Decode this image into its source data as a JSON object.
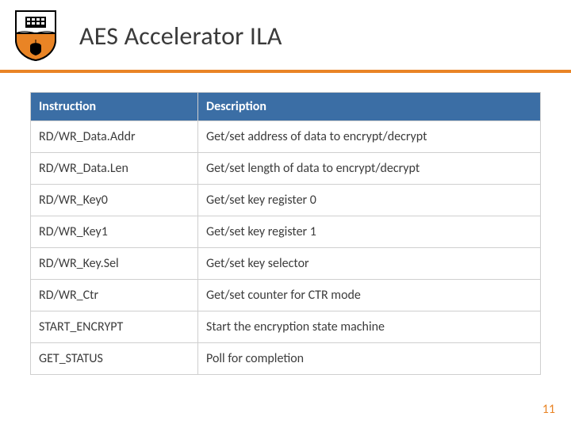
{
  "title": "AES Accelerator ILA",
  "columns": {
    "instruction": "Instruction",
    "description": "Description"
  },
  "rows": [
    {
      "instr": "RD/WR_Data.Addr",
      "desc": "Get/set address of data to encrypt/decrypt"
    },
    {
      "instr": "RD/WR_Data.Len",
      "desc": "Get/set length of data to encrypt/decrypt"
    },
    {
      "instr": "RD/WR_Key0",
      "desc": "Get/set key register 0"
    },
    {
      "instr": "RD/WR_Key1",
      "desc": "Get/set key register 1"
    },
    {
      "instr": "RD/WR_Key.Sel",
      "desc": "Get/set key selector"
    },
    {
      "instr": "RD/WR_Ctr",
      "desc": "Get/set counter for CTR mode"
    },
    {
      "instr": "START_ENCRYPT",
      "desc": "Start the encryption state machine"
    },
    {
      "instr": "GET_STATUS",
      "desc": "Poll for completion"
    }
  ],
  "page_number": "11"
}
